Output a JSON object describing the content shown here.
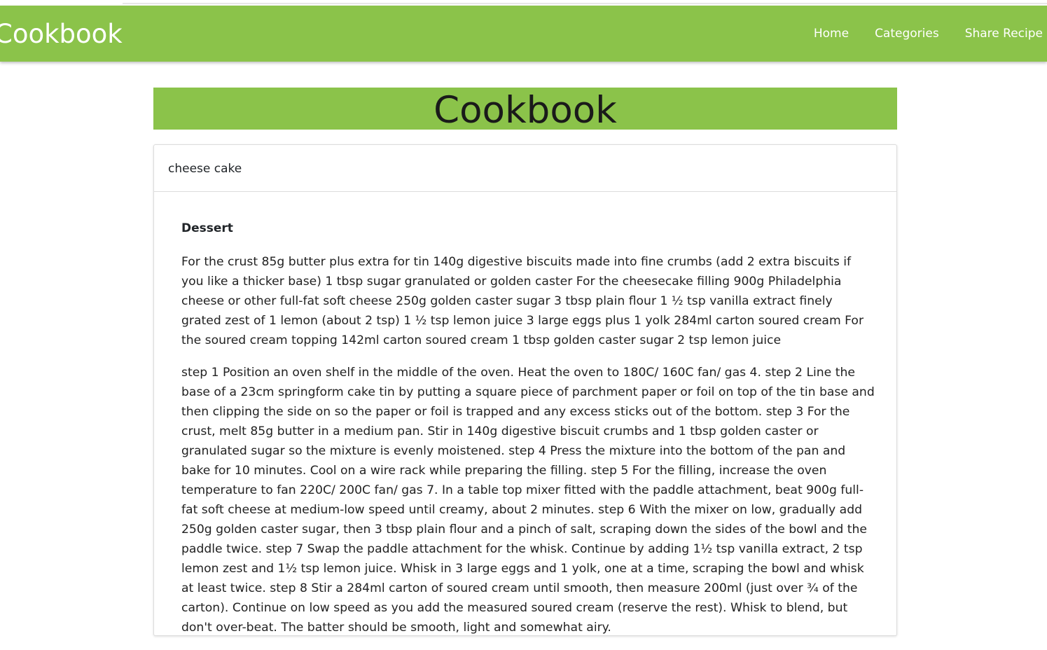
{
  "navbar": {
    "brand": "Cookbook",
    "links": [
      "Home",
      "Categories",
      "Share Recipe"
    ]
  },
  "hero": {
    "title": "Cookbook"
  },
  "recipe": {
    "name": "cheese cake",
    "category": "Dessert",
    "ingredients": "For the crust 85g butter plus extra for tin 140g digestive biscuits made into fine crumbs (add 2 extra biscuits if you like a thicker base) 1 tbsp sugar granulated or golden caster For the cheesecake filling 900g Philadelphia cheese or other full-fat soft cheese 250g golden caster sugar 3 tbsp plain flour 1 ½ tsp vanilla extract finely grated zest of 1 lemon (about 2 tsp) 1 ½ tsp lemon juice 3 large eggs plus 1 yolk 284ml carton soured cream For the soured cream topping 142ml carton soured cream 1 tbsp golden caster sugar 2 tsp lemon juice",
    "steps": "step 1 Position an oven shelf in the middle of the oven. Heat the oven to 180C/ 160C fan/ gas 4. step 2 Line the base of a 23cm springform cake tin by putting a square piece of parchment paper or foil on top of the tin base and then clipping the side on so the paper or foil is trapped and any excess sticks out of the bottom. step 3 For the crust, melt 85g butter in a medium pan. Stir in 140g digestive biscuit crumbs and 1 tbsp golden caster or granulated sugar so the mixture is evenly moistened. step 4 Press the mixture into the bottom of the pan and bake for 10 minutes. Cool on a wire rack while preparing the filling. step 5 For the filling, increase the oven temperature to fan 220C/ 200C fan/ gas 7. In a table top mixer fitted with the paddle attachment, beat 900g full-fat soft cheese at medium-low speed until creamy, about 2 minutes. step 6 With the mixer on low, gradually add 250g golden caster sugar, then 3 tbsp plain flour and a pinch of salt, scraping down the sides of the bowl and the paddle twice. step 7 Swap the paddle attachment for the whisk. Continue by adding 1½ tsp vanilla extract, 2 tsp lemon zest and 1½ tsp lemon juice. Whisk in 3 large eggs and 1 yolk, one at a time, scraping the bowl and whisk at least twice. step 8 Stir a 284ml carton of soured cream until smooth, then measure 200ml (just over ¾ of the carton). Continue on low speed as you add the measured soured cream (reserve the rest). Whisk to blend, but don't over-beat. The batter should be smooth, light and somewhat airy."
  },
  "colors": {
    "accent": "#8bc34a"
  }
}
